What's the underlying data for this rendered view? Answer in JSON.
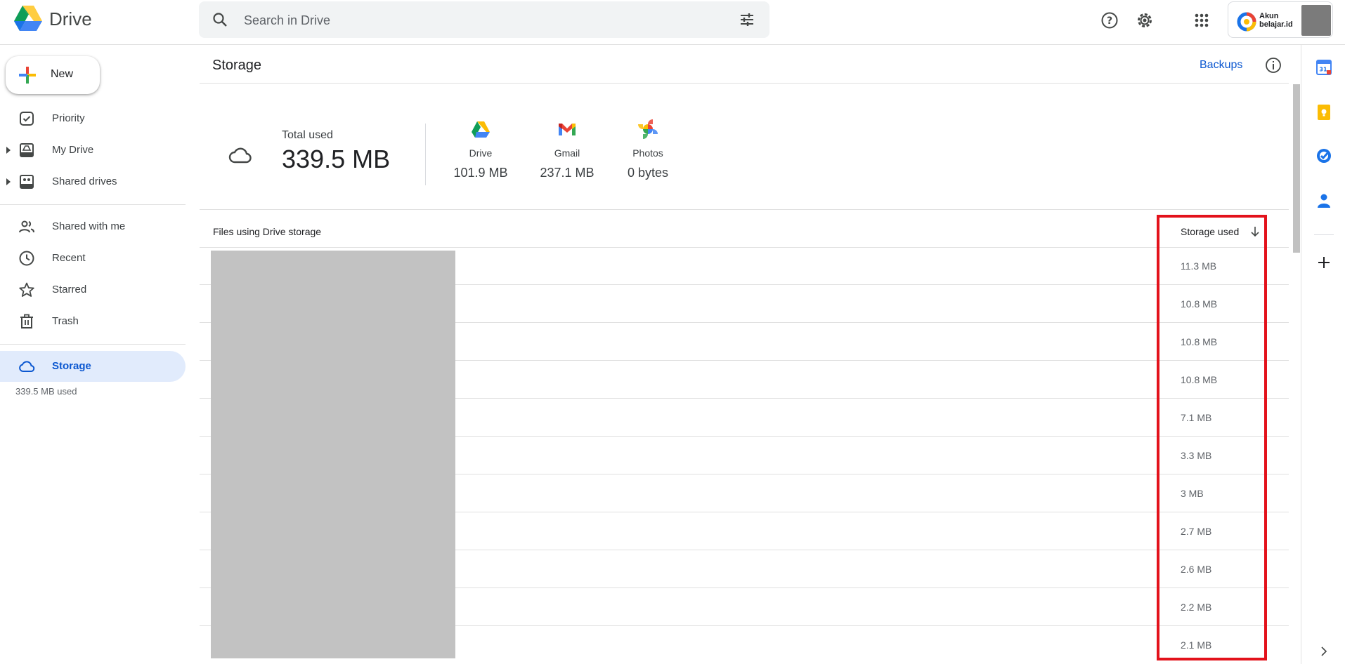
{
  "app": {
    "name": "Drive"
  },
  "search": {
    "placeholder": "Search in Drive"
  },
  "account": {
    "line1": "Akun",
    "line2": "belajar.id"
  },
  "sidebar": {
    "new_label": "New",
    "items": [
      {
        "label": "Priority",
        "icon": "priority-icon"
      },
      {
        "label": "My Drive",
        "icon": "my-drive-icon"
      },
      {
        "label": "Shared drives",
        "icon": "shared-drives-icon"
      },
      {
        "label": "Shared with me",
        "icon": "people-icon"
      },
      {
        "label": "Recent",
        "icon": "clock-icon"
      },
      {
        "label": "Starred",
        "icon": "star-icon"
      },
      {
        "label": "Trash",
        "icon": "trash-icon"
      },
      {
        "label": "Storage",
        "icon": "cloud-icon",
        "active": true
      }
    ],
    "storage_used": "339.5 MB used"
  },
  "main": {
    "title": "Storage",
    "backups_label": "Backups",
    "summary": {
      "total_label": "Total used",
      "total_value": "339.5 MB",
      "services": [
        {
          "name": "Drive",
          "size": "101.9 MB"
        },
        {
          "name": "Gmail",
          "size": "237.1 MB"
        },
        {
          "name": "Photos",
          "size": "0 bytes"
        }
      ]
    },
    "files": {
      "title": "Files using Drive storage",
      "column_header": "Storage used",
      "sizes": [
        "11.3 MB",
        "10.8 MB",
        "10.8 MB",
        "10.8 MB",
        "7.1 MB",
        "3.3 MB",
        "3 MB",
        "2.7 MB",
        "2.6 MB",
        "2.2 MB",
        "2.1 MB"
      ]
    }
  },
  "colors": {
    "accent": "#0b57d0",
    "highlight": "#e3121b",
    "active_bg": "#e1ebfc"
  }
}
